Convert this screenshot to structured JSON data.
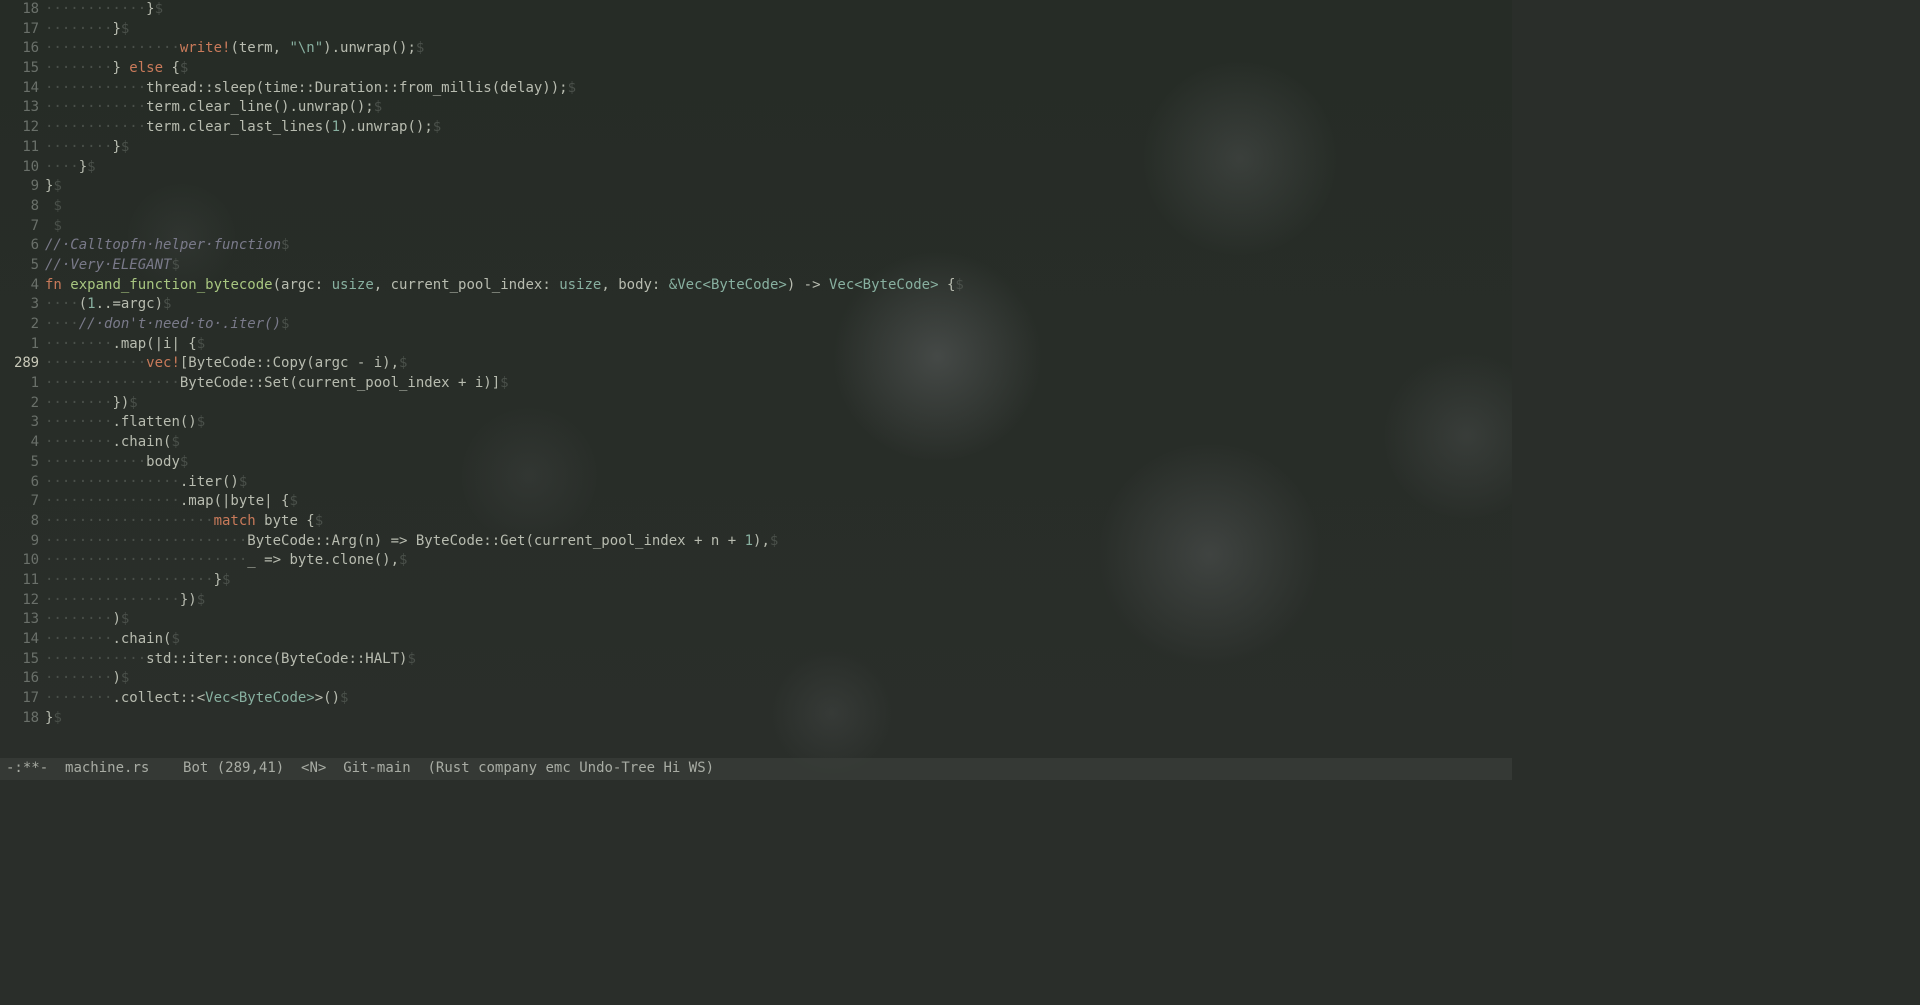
{
  "cursor_line_abs": "289",
  "lines": [
    {
      "rel": "18",
      "ws": "············",
      "tokens": [
        {
          "t": "}"
        }
      ]
    },
    {
      "rel": "17",
      "ws": "········",
      "tokens": [
        {
          "t": "}"
        }
      ]
    },
    {
      "rel": "16",
      "ws": "················",
      "tokens": [
        {
          "t": "write!",
          "c": "mac"
        },
        {
          "t": "(term, "
        },
        {
          "t": "\"\\n\"",
          "c": "ty"
        },
        {
          "t": ").unwrap();"
        }
      ]
    },
    {
      "rel": "15",
      "ws": "········",
      "tokens": [
        {
          "t": "} "
        },
        {
          "t": "else",
          "c": "kw"
        },
        {
          "t": " {"
        }
      ]
    },
    {
      "rel": "14",
      "ws": "············",
      "tokens": [
        {
          "t": "thread::sleep(time::Duration::from_millis(delay));"
        }
      ]
    },
    {
      "rel": "13",
      "ws": "············",
      "tokens": [
        {
          "t": "term.clear_line().unwrap();"
        }
      ]
    },
    {
      "rel": "12",
      "ws": "············",
      "tokens": [
        {
          "t": "term.clear_last_lines("
        },
        {
          "t": "1",
          "c": "ty"
        },
        {
          "t": ").unwrap();"
        }
      ]
    },
    {
      "rel": "11",
      "ws": "········",
      "tokens": [
        {
          "t": "}"
        }
      ]
    },
    {
      "rel": "10",
      "ws": "····",
      "tokens": [
        {
          "t": "}"
        }
      ]
    },
    {
      "rel": "9",
      "ws": "",
      "tokens": [
        {
          "t": "}"
        }
      ]
    },
    {
      "rel": "8",
      "ws": "",
      "tokens": [
        {
          "t": " "
        }
      ]
    },
    {
      "rel": "7",
      "ws": "",
      "tokens": [
        {
          "t": " "
        }
      ]
    },
    {
      "rel": "6",
      "ws": "",
      "tokens": [
        {
          "t": "// Calltopfn helper function",
          "c": "cm"
        }
      ]
    },
    {
      "rel": "5",
      "ws": "",
      "tokens": [
        {
          "t": "// Very ELEGANT",
          "c": "cm"
        }
      ]
    },
    {
      "rel": "4",
      "ws": "",
      "tokens": [
        {
          "t": "fn ",
          "c": "kw"
        },
        {
          "t": "expand_function_bytecode",
          "c": "fn"
        },
        {
          "t": "(argc: "
        },
        {
          "t": "usize",
          "c": "ty"
        },
        {
          "t": ", current_pool_index: "
        },
        {
          "t": "usize",
          "c": "ty"
        },
        {
          "t": ", body: "
        },
        {
          "t": "&Vec<ByteCode>",
          "c": "ty"
        },
        {
          "t": ") -> "
        },
        {
          "t": "Vec<ByteCode>",
          "c": "ty"
        },
        {
          "t": " {"
        }
      ]
    },
    {
      "rel": "3",
      "ws": "····",
      "tokens": [
        {
          "t": "("
        },
        {
          "t": "1",
          "c": "ty"
        },
        {
          "t": "..=argc)"
        }
      ]
    },
    {
      "rel": "2",
      "ws": "····",
      "tokens": [
        {
          "t": "// don't need to .iter()",
          "c": "cm"
        }
      ]
    },
    {
      "rel": "1",
      "ws": "········",
      "tokens": [
        {
          "t": ".map(|i| {"
        }
      ]
    },
    {
      "rel": "289",
      "current": true,
      "ws": "············",
      "tokens": [
        {
          "t": "vec!",
          "c": "mac"
        },
        {
          "t": "[ByteCode::Copy(argc - i),"
        }
      ]
    },
    {
      "rel": "1",
      "ws": "················",
      "tokens": [
        {
          "t": "ByteCode::Set(current_pool_index + i)]"
        }
      ]
    },
    {
      "rel": "2",
      "ws": "········",
      "tokens": [
        {
          "t": "})"
        }
      ]
    },
    {
      "rel": "3",
      "ws": "········",
      "tokens": [
        {
          "t": ".flatten()"
        }
      ]
    },
    {
      "rel": "4",
      "ws": "········",
      "tokens": [
        {
          "t": ".chain("
        }
      ]
    },
    {
      "rel": "5",
      "ws": "············",
      "tokens": [
        {
          "t": "body"
        }
      ]
    },
    {
      "rel": "6",
      "ws": "················",
      "tokens": [
        {
          "t": ".iter()"
        }
      ]
    },
    {
      "rel": "7",
      "ws": "················",
      "tokens": [
        {
          "t": ".map(|byte| {"
        }
      ]
    },
    {
      "rel": "8",
      "ws": "····················",
      "tokens": [
        {
          "t": "match",
          "c": "kw"
        },
        {
          "t": " byte {"
        }
      ]
    },
    {
      "rel": "9",
      "ws": "························",
      "tokens": [
        {
          "t": "ByteCode::Arg(n) => ByteCode::Get(current_pool_index + n + "
        },
        {
          "t": "1",
          "c": "ty"
        },
        {
          "t": "),"
        }
      ]
    },
    {
      "rel": "10",
      "ws": "························",
      "tokens": [
        {
          "t": "_ => byte.clone(),"
        }
      ]
    },
    {
      "rel": "11",
      "ws": "····················",
      "tokens": [
        {
          "t": "}"
        }
      ]
    },
    {
      "rel": "12",
      "ws": "················",
      "tokens": [
        {
          "t": "})"
        }
      ]
    },
    {
      "rel": "13",
      "ws": "········",
      "tokens": [
        {
          "t": ")"
        }
      ]
    },
    {
      "rel": "14",
      "ws": "········",
      "tokens": [
        {
          "t": ".chain("
        }
      ]
    },
    {
      "rel": "15",
      "ws": "············",
      "tokens": [
        {
          "t": "std::iter::once(ByteCode::HALT)"
        }
      ]
    },
    {
      "rel": "16",
      "ws": "········",
      "tokens": [
        {
          "t": ")"
        }
      ]
    },
    {
      "rel": "17",
      "ws": "········",
      "tokens": [
        {
          "t": ".collect::<"
        },
        {
          "t": "Vec<ByteCode>",
          "c": "ty"
        },
        {
          "t": ">()"
        }
      ]
    },
    {
      "rel": "18",
      "ws": "",
      "tokens": [
        {
          "t": "}"
        }
      ]
    }
  ],
  "status": {
    "modified": "-:**-",
    "filename": "machine.rs",
    "position": "Bot (289,41)",
    "mode": "<N>",
    "vc": "Git-main",
    "modes": "(Rust company emc Undo-Tree Hi WS)"
  }
}
